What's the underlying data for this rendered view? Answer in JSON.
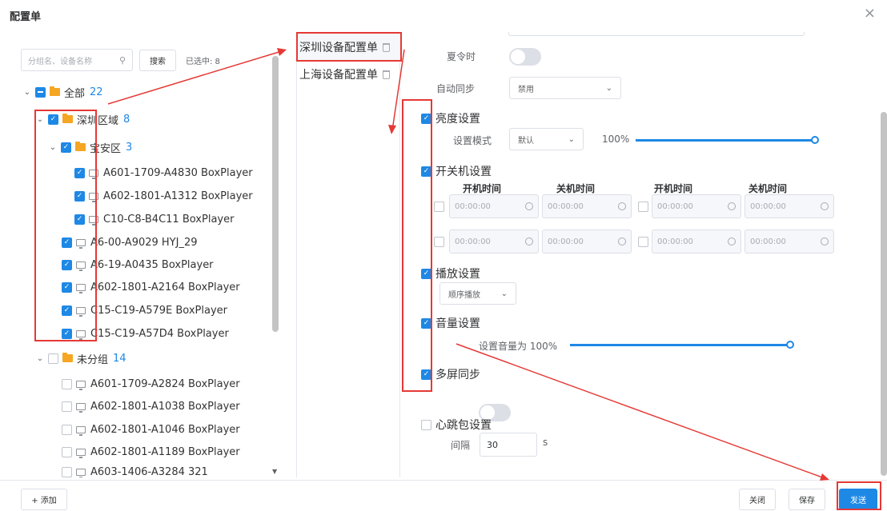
{
  "dialog": {
    "title": "配置单",
    "close": "×"
  },
  "left": {
    "search_placeholder": "分组名、设备名称",
    "search_button": "搜索",
    "selected_count": "已选中: 8",
    "tree": {
      "root": {
        "label": "全部",
        "count": "22"
      },
      "groups": [
        {
          "label": "深圳区域",
          "count": "8"
        },
        {
          "label": "宝安区",
          "count": "3"
        }
      ],
      "devices_baoan": [
        "A601-1709-A4830 BoxPlayer",
        "A602-1801-A1312 BoxPlayer",
        "C10-C8-B4C11 BoxPlayer"
      ],
      "devices_sz": [
        "A6-00-A9029 HYJ_29",
        "A6-19-A0435 BoxPlayer",
        "A602-1801-A2164 BoxPlayer",
        "C15-C19-A579E BoxPlayer",
        "C15-C19-A57D4 BoxPlayer"
      ],
      "ungrouped": {
        "label": "未分组",
        "count": "14"
      },
      "devices_ungrouped": [
        "A601-1709-A2824 BoxPlayer",
        "A602-1801-A1038 BoxPlayer",
        "A602-1801-A1046 BoxPlayer",
        "A602-1801-A1189 BoxPlayer",
        "A603-1406-A3284 321"
      ]
    }
  },
  "configs": [
    "深圳设备配置单",
    "上海设备配置单"
  ],
  "settings": {
    "dst_label": "夏令时",
    "auto_sync_label": "自动同步",
    "auto_sync_value": "禁用",
    "brightness": {
      "title": "亮度设置",
      "mode_label": "设置模式",
      "mode_value": "默认",
      "percent": "100%",
      "level": 1.0
    },
    "power": {
      "title": "开关机设置",
      "headers": [
        "开机时间",
        "关机时间",
        "开机时间",
        "关机时间"
      ],
      "time_placeholder": "00:00:00"
    },
    "play": {
      "title": "播放设置",
      "mode": "顺序播放"
    },
    "volume": {
      "title": "音量设置",
      "text": "设置音量为 100%",
      "level": 1.0
    },
    "multiscreen": {
      "title": "多屏同步"
    },
    "heartbeat": {
      "title": "心跳包设置",
      "interval_label": "间隔",
      "interval_value": "30",
      "unit": "s"
    }
  },
  "footer": {
    "add": "+ 添加",
    "close": "关闭",
    "save": "保存",
    "send": "发送"
  },
  "colors": {
    "accent": "#1e88e5",
    "annotation": "#e53935",
    "folder": "#f5a623"
  }
}
